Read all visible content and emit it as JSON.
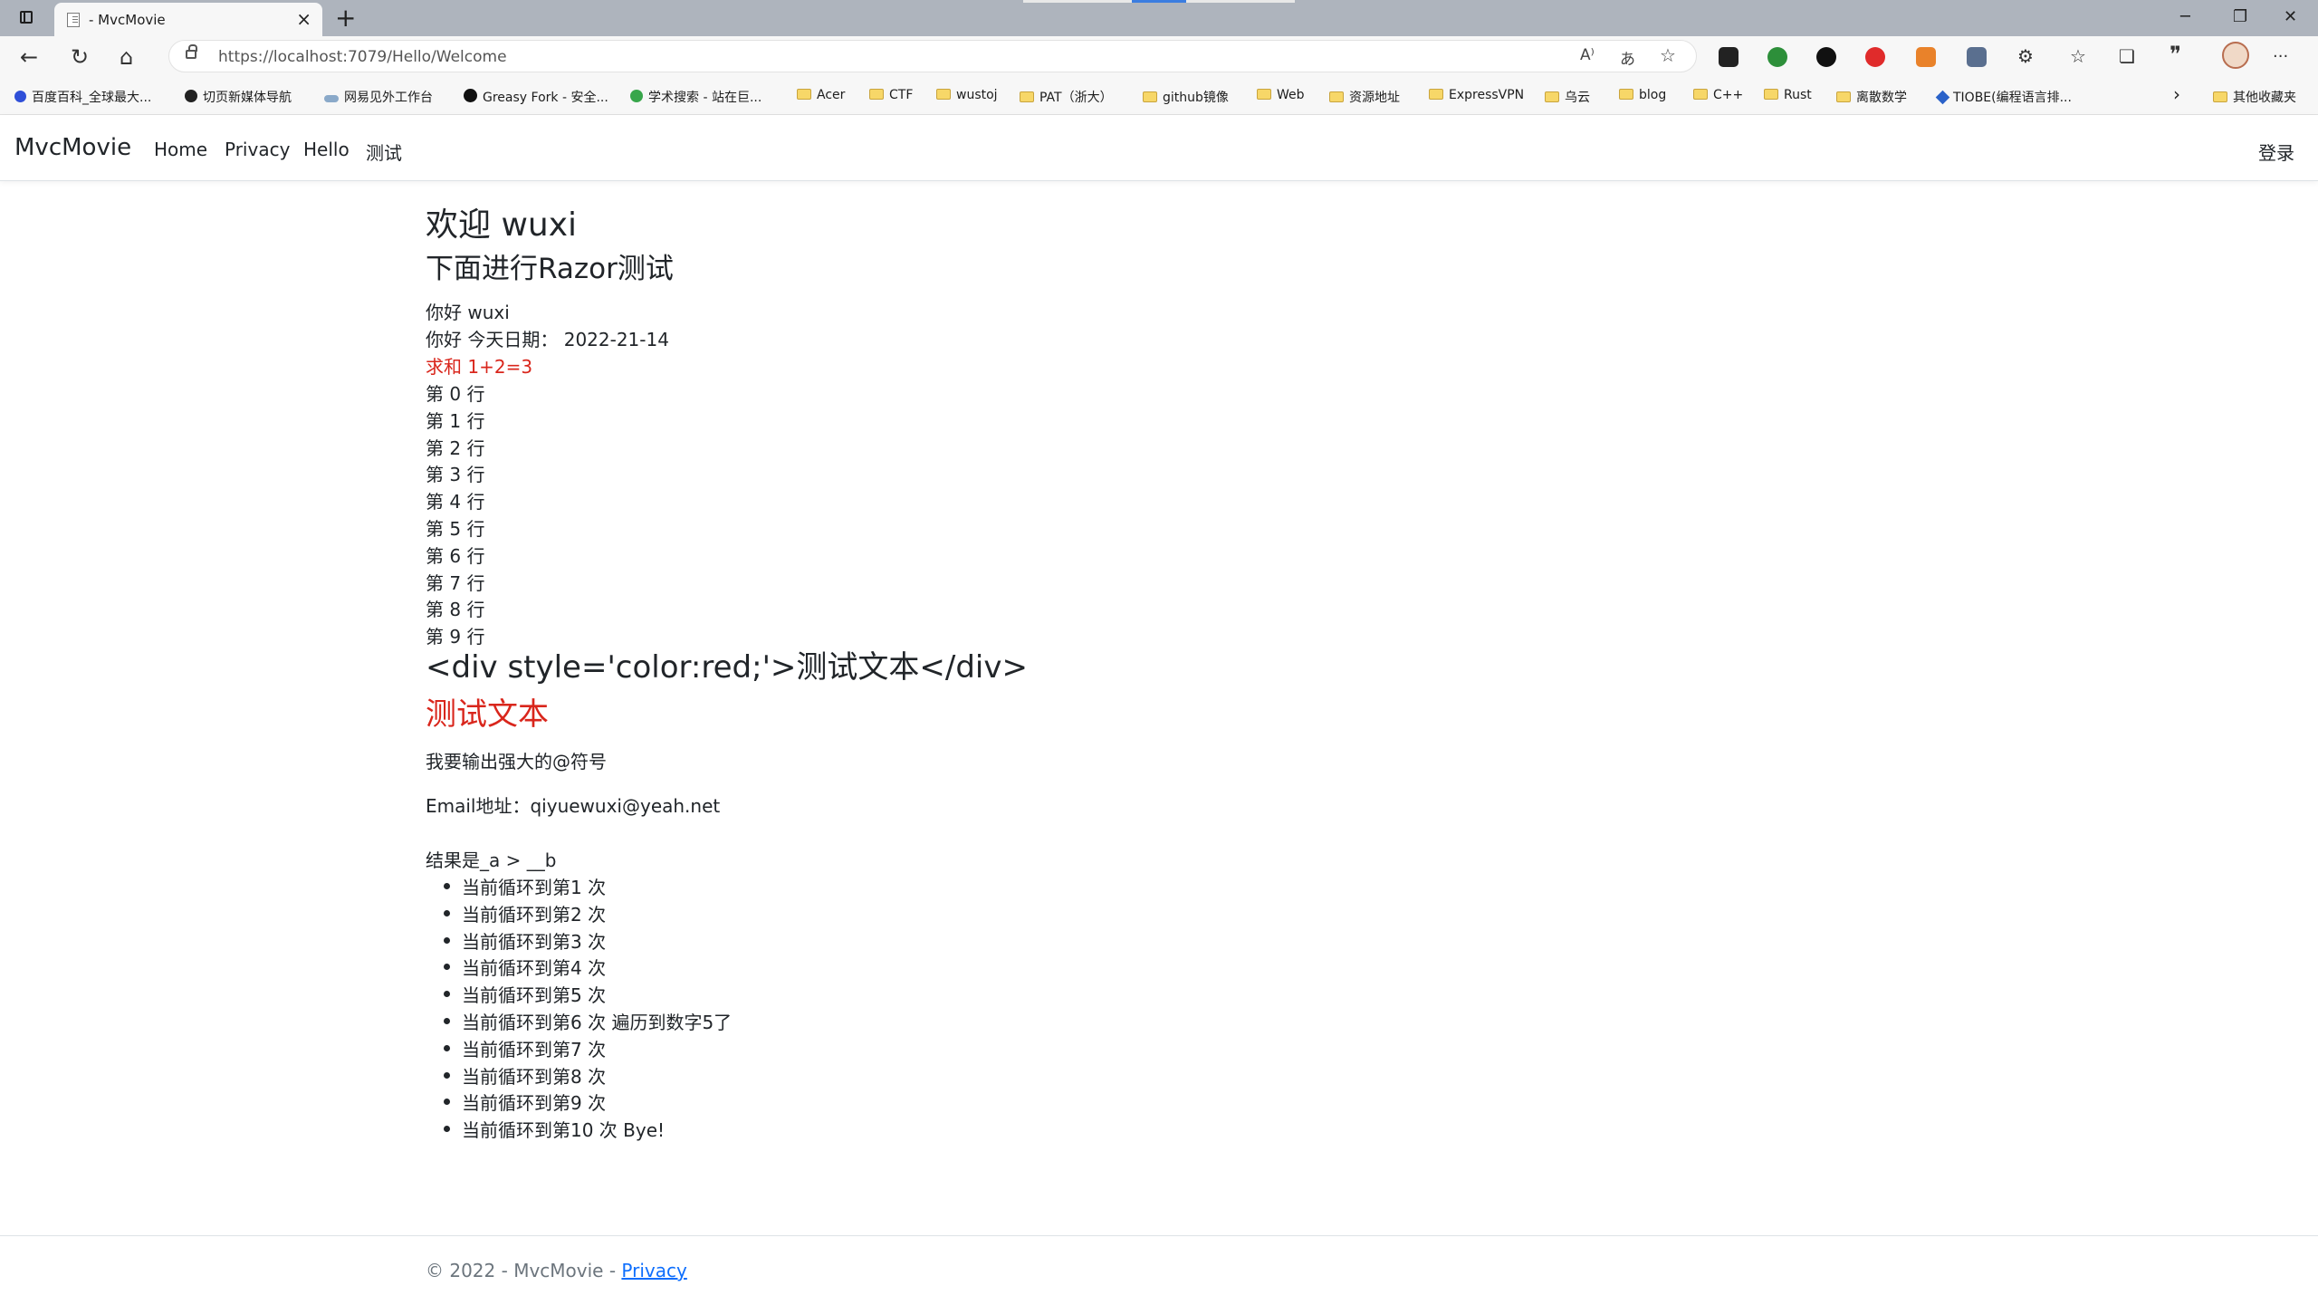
{
  "browser": {
    "tab_title": "- MvcMovie",
    "close_glyph": "×",
    "new_tab_glyph": "+",
    "url": "https://localhost:7079/Hello/Welcome",
    "window_controls": {
      "minimize": "─",
      "restore": "❐",
      "close": "✕"
    },
    "nav": {
      "back": "←",
      "reload": "↻",
      "home": "⌂"
    },
    "omnibox_icons": {
      "read_aloud": "A⁾",
      "translate": "あ",
      "favorite": "☆"
    },
    "bookmarks": [
      {
        "label": "百度百科_全球最大...",
        "icon": "baidu-icon"
      },
      {
        "label": "切页新媒体导航",
        "icon": "wordpress-icon"
      },
      {
        "label": "网易见外工作台",
        "icon": "cloud-icon"
      },
      {
        "label": "Greasy Fork - 安全...",
        "icon": "greasyfork-icon"
      },
      {
        "label": "学术搜索 - 站在巨...",
        "icon": "scholar-icon"
      },
      {
        "label": "Acer",
        "icon": "folder-icon"
      },
      {
        "label": "CTF",
        "icon": "folder-icon"
      },
      {
        "label": "wustoj",
        "icon": "folder-icon"
      },
      {
        "label": "PAT（浙大）",
        "icon": "folder-icon"
      },
      {
        "label": "github镜像",
        "icon": "folder-icon"
      },
      {
        "label": "Web",
        "icon": "folder-icon"
      },
      {
        "label": "资源地址",
        "icon": "folder-icon"
      },
      {
        "label": "ExpressVPN",
        "icon": "folder-icon"
      },
      {
        "label": "乌云",
        "icon": "folder-icon"
      },
      {
        "label": "blog",
        "icon": "folder-icon"
      },
      {
        "label": "C++",
        "icon": "folder-icon"
      },
      {
        "label": "Rust",
        "icon": "folder-icon"
      },
      {
        "label": "离散数学",
        "icon": "folder-icon"
      },
      {
        "label": "TIOBE(编程语言排...",
        "icon": "tiobe-icon"
      }
    ],
    "bookmarks_more": "›",
    "other_bookmarks": "其他收藏夹",
    "extension_more": "···"
  },
  "navbar": {
    "brand": "MvcMovie",
    "links": [
      "Home",
      "Privacy",
      "Hello",
      "测试"
    ],
    "login": "登录"
  },
  "main": {
    "welcome": "欢迎 wuxi",
    "razor_heading": "下面进行Razor测试",
    "hello": "你好 wuxi",
    "date_line": "你好 今天日期： 2022-21-14",
    "sum_line": "求和 1+2=3",
    "rows": [
      "第 0 行",
      "第 1 行",
      "第 2 行",
      "第 3 行",
      "第 4 行",
      "第 5 行",
      "第 6 行",
      "第 7 行",
      "第 8 行",
      "第 9 行"
    ],
    "raw_html": "<div style='color:red;'>测试文本</div>",
    "rendered_text": "测试文本",
    "at_line": "我要输出强大的@符号",
    "email_line": "Email地址：qiyuewuxi@yeah.net",
    "result_line": "结果是_a > __b",
    "loop_items": [
      "当前循环到第1 次",
      "当前循环到第2 次",
      "当前循环到第3 次",
      "当前循环到第4 次",
      "当前循环到第5 次",
      "当前循环到第6 次 遍历到数字5了",
      "当前循环到第7 次",
      "当前循环到第8 次",
      "当前循环到第9 次",
      "当前循环到第10 次 Bye!"
    ]
  },
  "footer": {
    "copyright": "© 2022 - MvcMovie - ",
    "privacy_link": "Privacy"
  },
  "colors": {
    "accent_red": "#d9261c",
    "link_blue": "#0d6efd",
    "titlebar": "#aeb4bd"
  }
}
